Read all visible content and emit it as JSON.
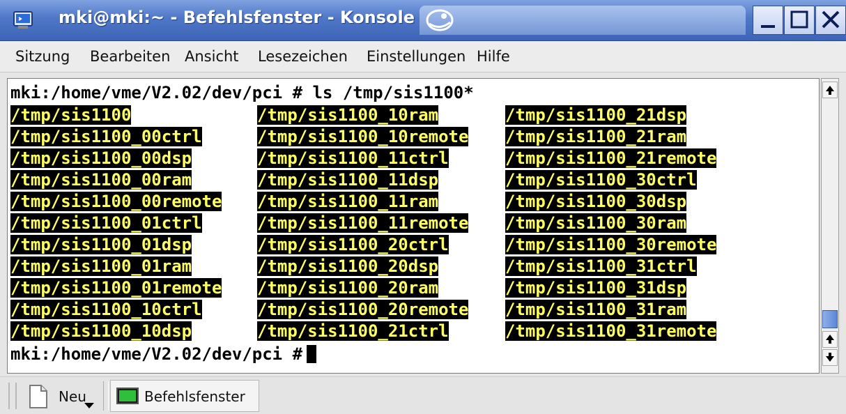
{
  "window": {
    "title": "mki@mki:~ - Befehlsfenster - Konsole",
    "controls": {
      "minimize": "minimize-icon",
      "maximize": "maximize-icon",
      "close": "close-icon"
    }
  },
  "menu": {
    "items": [
      "Sitzung",
      "Bearbeiten",
      "Ansicht",
      "Lesezeichen",
      "Einstellungen",
      "Hilfe"
    ]
  },
  "terminal": {
    "prompt": "mki:/home/vme/V2.02/dev/pci #",
    "command_line": "mki:/home/vme/V2.02/dev/pci # ls /tmp/sis1100*",
    "listing": [
      [
        "/tmp/sis1100",
        "/tmp/sis1100_10ram",
        "/tmp/sis1100_21dsp"
      ],
      [
        "/tmp/sis1100_00ctrl",
        "/tmp/sis1100_10remote",
        "/tmp/sis1100_21ram"
      ],
      [
        "/tmp/sis1100_00dsp",
        "/tmp/sis1100_11ctrl",
        "/tmp/sis1100_21remote"
      ],
      [
        "/tmp/sis1100_00ram",
        "/tmp/sis1100_11dsp",
        "/tmp/sis1100_30ctrl"
      ],
      [
        "/tmp/sis1100_00remote",
        "/tmp/sis1100_11ram",
        "/tmp/sis1100_30dsp"
      ],
      [
        "/tmp/sis1100_01ctrl",
        "/tmp/sis1100_11remote",
        "/tmp/sis1100_30ram"
      ],
      [
        "/tmp/sis1100_01dsp",
        "/tmp/sis1100_20ctrl",
        "/tmp/sis1100_30remote"
      ],
      [
        "/tmp/sis1100_01ram",
        "/tmp/sis1100_20dsp",
        "/tmp/sis1100_31ctrl"
      ],
      [
        "/tmp/sis1100_01remote",
        "/tmp/sis1100_20ram",
        "/tmp/sis1100_31dsp"
      ],
      [
        "/tmp/sis1100_10ctrl",
        "/tmp/sis1100_20remote",
        "/tmp/sis1100_31ram"
      ],
      [
        "/tmp/sis1100_10dsp",
        "/tmp/sis1100_21ctrl",
        "/tmp/sis1100_31remote"
      ]
    ],
    "colors": {
      "highlight_bg": "#000000",
      "highlight_fg": "#ffff66",
      "text": "#000000",
      "background": "#ffffff"
    }
  },
  "tabbar": {
    "new_label": "Neu",
    "session_label": "Befehlsfenster"
  },
  "colors": {
    "titlebar": "#4f77c8",
    "scroll_thumb": "#5c86d6"
  }
}
